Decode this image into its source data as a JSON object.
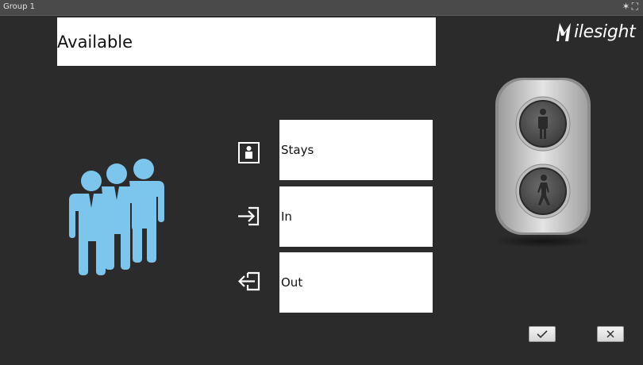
{
  "window": {
    "title": "Group 1",
    "controls": "✶ ⛶"
  },
  "status": {
    "value": "Available"
  },
  "brand": {
    "name": "ilesight",
    "accent": "#ffffff"
  },
  "counters": {
    "stays_label": "Stays",
    "in_label": "In",
    "out_label": "Out"
  },
  "colors": {
    "background": "#2b2b2b",
    "people": "#7cc5ec",
    "light_body": "#cfcfcf"
  },
  "icons": {
    "stays": "person-frame-icon",
    "in": "enter-arrow-icon",
    "out": "exit-arrow-icon",
    "confirm": "checkmark-icon",
    "cancel": "close-icon"
  }
}
